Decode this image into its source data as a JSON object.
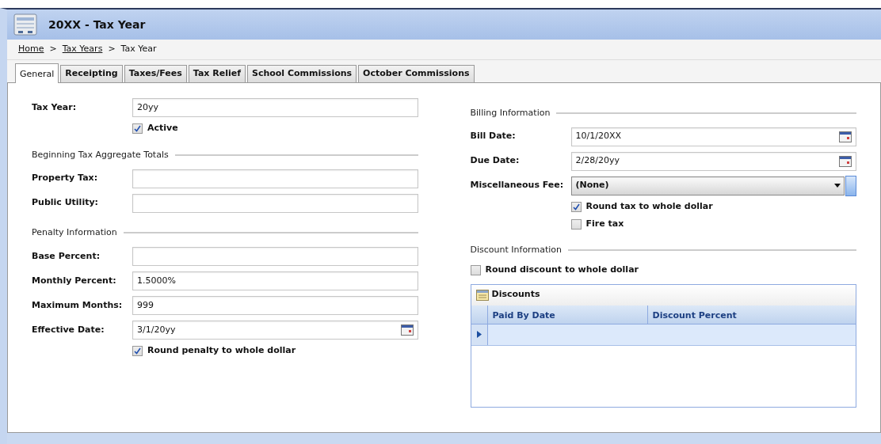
{
  "window": {
    "title": "20XX - Tax Year"
  },
  "breadcrumb": [
    {
      "kind": "link",
      "label": "Home"
    },
    {
      "kind": "separator",
      "label": ">"
    },
    {
      "kind": "link",
      "label": "Tax Years"
    },
    {
      "kind": "separator",
      "label": ">"
    },
    {
      "kind": "current",
      "label": "Tax Year"
    }
  ],
  "tabs": [
    {
      "label": "General",
      "selected": true
    },
    {
      "label": "Receipting",
      "selected": false
    },
    {
      "label": "Taxes/Fees",
      "selected": false
    },
    {
      "label": "Tax Relief",
      "selected": false
    },
    {
      "label": "School Commissions",
      "selected": false
    },
    {
      "label": "October Commissions",
      "selected": false
    }
  ],
  "left_sections": [
    {
      "rows": [
        {
          "kind": "text",
          "label": "Tax Year:",
          "value": "20yy"
        },
        {
          "kind": "checkbox",
          "label": "Active",
          "checked": true
        }
      ]
    },
    {
      "title": "Beginning Tax Aggregate Totals",
      "rows": [
        {
          "kind": "text",
          "label": "Property Tax:"
        },
        {
          "kind": "text",
          "label": "Public Utility:"
        }
      ]
    },
    {
      "title": "Penalty Information",
      "rows": [
        {
          "kind": "text",
          "label": "Base Percent:"
        },
        {
          "kind": "text",
          "label": "Monthly Percent:",
          "value": "1.5000%"
        },
        {
          "kind": "text",
          "label": "Maximum Months:",
          "value": "999"
        },
        {
          "kind": "date",
          "label": "Effective Date:",
          "value": "3/1/20yy"
        },
        {
          "kind": "checkbox",
          "label": "Round penalty to whole dollar",
          "checked": true
        }
      ]
    }
  ],
  "right_sections": [
    {
      "title": "Billing Information",
      "rows": [
        {
          "kind": "date",
          "label": "Bill Date:",
          "value": "10/1/20XX"
        },
        {
          "kind": "date",
          "label": "Due Date:",
          "value": "2/28/20yy"
        },
        {
          "kind": "select",
          "label": "Miscellaneous Fee:",
          "value": "(None)"
        },
        {
          "kind": "checkbox",
          "label": "Round tax to whole dollar",
          "checked": true
        },
        {
          "kind": "checkbox",
          "label": "Fire tax",
          "checked": false
        }
      ]
    },
    {
      "title": "Discount Information",
      "rows": [
        {
          "kind": "plain_checkbox",
          "label": "Round discount to whole dollar",
          "checked": false
        }
      ],
      "grid": {
        "title": "Discounts",
        "columns": [
          "Paid By Date",
          "Discount Percent"
        ],
        "rows": [
          {
            "selected": true
          }
        ]
      }
    }
  ]
}
